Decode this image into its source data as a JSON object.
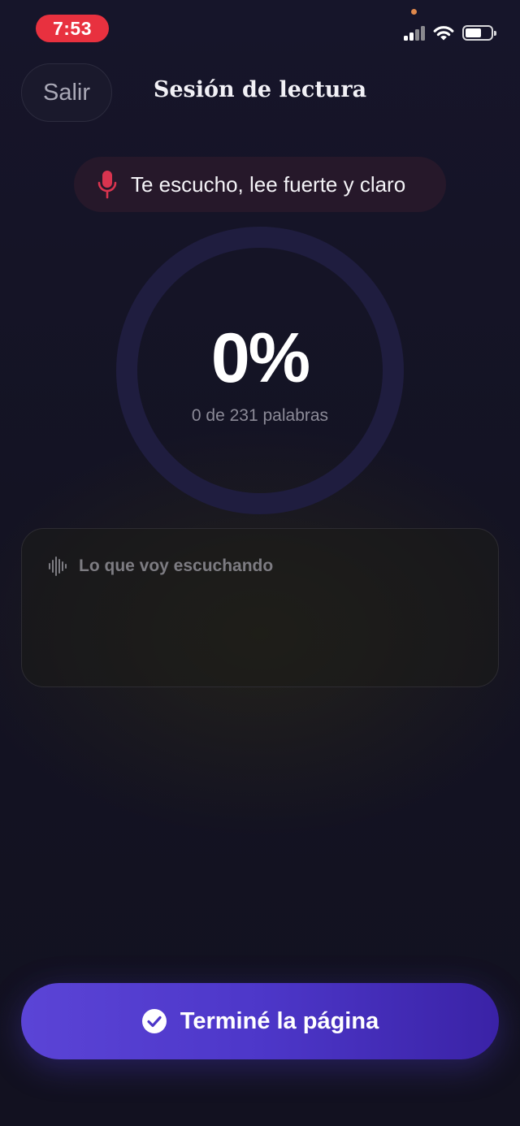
{
  "status_bar": {
    "time": "7:53"
  },
  "header": {
    "exit_label": "Salir",
    "title": "Sesión de lectura"
  },
  "listening": {
    "text": "Te escucho, lee fuerte y claro",
    "icon": "microphone-icon",
    "color": "#d9344f"
  },
  "progress": {
    "percent_label": "0%",
    "percent": 0,
    "words_label": "0 de 231 palabras",
    "ring_color": "#1f1d3f"
  },
  "transcript": {
    "label": "Lo que voy escuchando",
    "icon": "waveform-icon",
    "content": ""
  },
  "finish": {
    "label": "Terminé la página",
    "icon": "check-circle-icon",
    "accent": "#5b44d6"
  }
}
